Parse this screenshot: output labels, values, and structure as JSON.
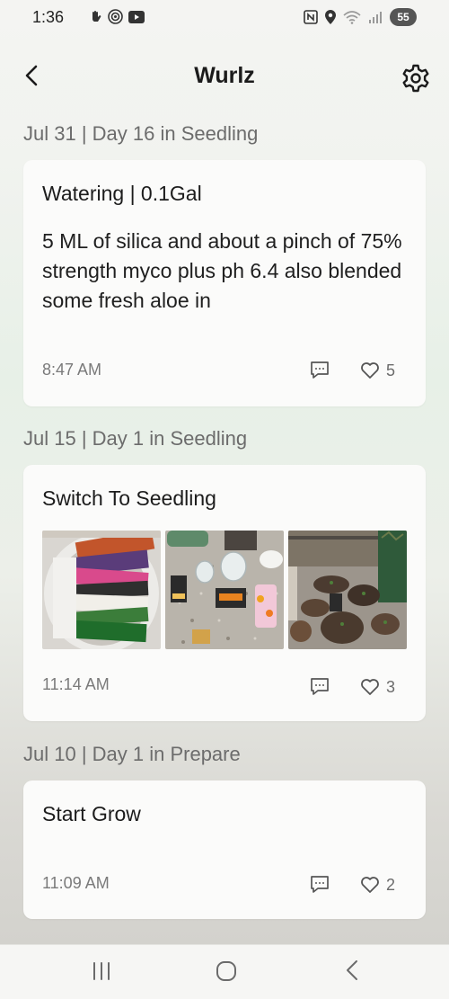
{
  "status_bar": {
    "time": "1:36",
    "battery_level": "55",
    "left_icons": [
      "hand-icon",
      "record-icon",
      "youtube-icon"
    ],
    "right_icons": [
      "nfc-icon",
      "location-icon",
      "wifi-icon",
      "signal-icon",
      "battery-icon"
    ]
  },
  "header": {
    "title": "Wurlz",
    "back_icon": "chevron-left-icon",
    "settings_icon": "gear-icon"
  },
  "entries": [
    {
      "date": "Jul 31 | Day 16 in Seedling",
      "title": "Watering | 0.1Gal",
      "body": "5 ML of silica and about a pinch of 75% strength myco plus ph 6.4 also blended some fresh aloe in",
      "time": "8:47 AM",
      "likes": "5"
    },
    {
      "date": "Jul 15 | Day 1 in Seedling",
      "title": "Switch To Seedling",
      "photos": [
        "photo-seed-packets",
        "photo-supplies-on-counter",
        "photo-seedling-pots"
      ],
      "time": "11:14 AM",
      "likes": "3"
    },
    {
      "date": "Jul 10 | Day 1 in Prepare",
      "title": "Start Grow",
      "time": "11:09 AM",
      "likes": "2"
    }
  ],
  "nav_bar": {
    "icons": [
      "recent-apps-icon",
      "home-icon",
      "back-icon"
    ]
  },
  "colors": {
    "text_primary": "#1d1d1d",
    "text_secondary": "#6c6c6c",
    "card_bg": "#fbfbfa"
  }
}
